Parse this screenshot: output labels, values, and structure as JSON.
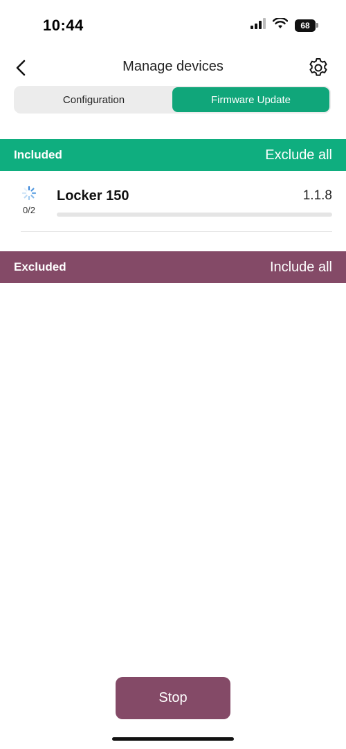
{
  "status_bar": {
    "time": "10:44",
    "battery": "68",
    "icons": [
      "signal-icon",
      "wifi-icon",
      "battery-icon"
    ]
  },
  "header": {
    "title": "Manage devices",
    "back_icon": "chevron-left-icon",
    "settings_icon": "gear-icon"
  },
  "tabs": [
    {
      "label": "Configuration",
      "active": false
    },
    {
      "label": "Firmware Update",
      "active": true
    }
  ],
  "included": {
    "title": "Included",
    "action": "Exclude all",
    "color": "#0fae7f",
    "devices": [
      {
        "name": "Locker 150",
        "version": "1.1.8",
        "progress_text": "0/2",
        "progress": 0,
        "status_icon": "spinner-icon"
      }
    ]
  },
  "excluded": {
    "title": "Excluded",
    "action": "Include all",
    "color": "#844a67"
  },
  "footer": {
    "stop_label": "Stop",
    "stop_color": "#844a67"
  },
  "colors": {
    "accent": "#10a67a",
    "secondary": "#844a67"
  }
}
